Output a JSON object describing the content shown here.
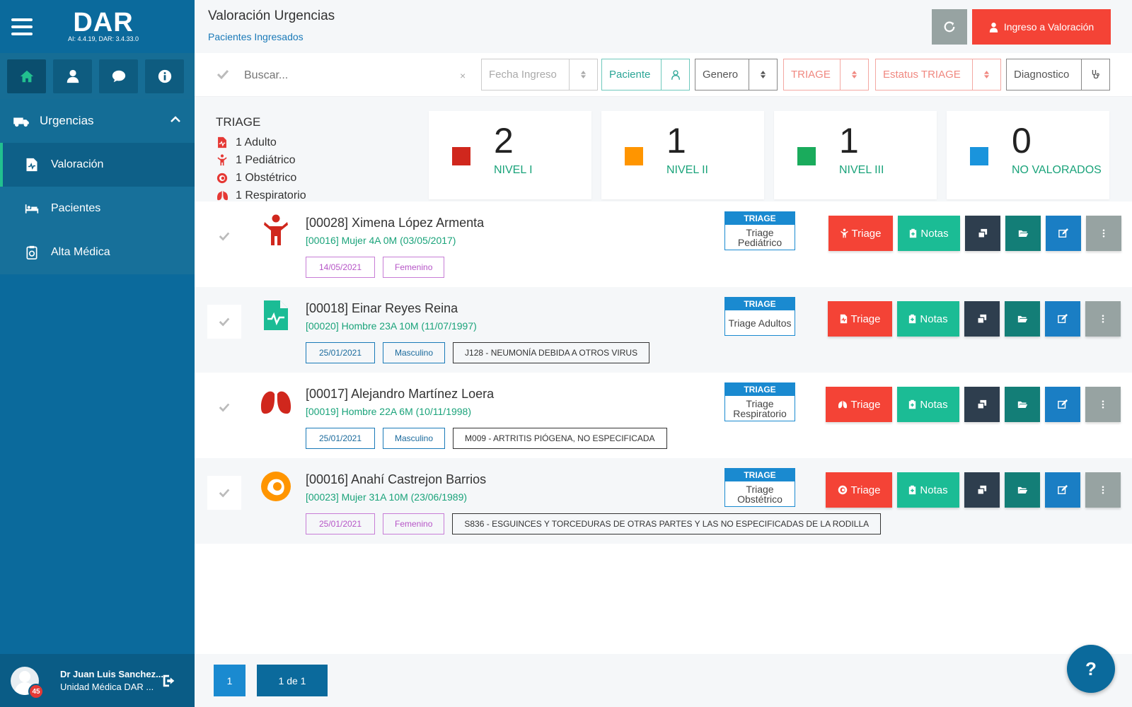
{
  "sidebar": {
    "brand": "DAR",
    "version": "AI: 4.4.19, DAR: 3.4.33.0",
    "section": "Urgencias",
    "items": [
      {
        "label": "Valoración",
        "active": true
      },
      {
        "label": "Pacientes",
        "active": false
      },
      {
        "label": "Alta Médica",
        "active": false
      }
    ],
    "user": {
      "name": "Dr Juan Luis Sanchez...",
      "unit": "Unidad Médica DAR ...",
      "badge": "45"
    }
  },
  "header": {
    "title": "Valoración Urgencias",
    "subtitle": "Pacientes Ingresados",
    "ingreso_label": "Ingreso a Valoración"
  },
  "filters": {
    "search_placeholder": "Buscar...",
    "clear": "×",
    "fecha": "Fecha Ingreso",
    "paciente": "Paciente",
    "genero": "Genero",
    "triage": "TRIAGE",
    "estatus": "Estatus TRIAGE",
    "diagnostico": "Diagnostico"
  },
  "summary": {
    "title": "TRIAGE",
    "rows": [
      "1 Adulto",
      "1 Pediátrico",
      "1 Obstétrico",
      "1 Respiratorio"
    ]
  },
  "levels": [
    {
      "count": "2",
      "label": "NIVEL I",
      "color": "#d0271d"
    },
    {
      "count": "1",
      "label": "NIVEL II",
      "color": "#ff9500"
    },
    {
      "count": "1",
      "label": "NIVEL III",
      "color": "#1aab5c"
    },
    {
      "count": "0",
      "label": "NO VALORADOS",
      "color": "#1a94dc"
    }
  ],
  "patients": [
    {
      "name": "[00028] Ximena López Armenta",
      "info": "[00016] Mujer 4A 0M (03/05/2017)",
      "date": "14/05/2021",
      "gender": "Femenino",
      "diagnosis": "",
      "triage_head": "TRIAGE",
      "triage_type": "Triage Pediátrico",
      "triage_btn": "Triage",
      "notes_btn": "Notas"
    },
    {
      "name": "[00018] Einar Reyes Reina",
      "info": "[00020] Hombre 23A 10M (11/07/1997)",
      "date": "25/01/2021",
      "gender": "Masculino",
      "diagnosis": "J128 - NEUMONÍA DEBIDA A OTROS VIRUS",
      "triage_head": "TRIAGE",
      "triage_type": "Triage Adultos",
      "triage_btn": "Triage",
      "notes_btn": "Notas"
    },
    {
      "name": "[00017] Alejandro Martínez Loera",
      "info": "[00019] Hombre 22A 6M (10/11/1998)",
      "date": "25/01/2021",
      "gender": "Masculino",
      "diagnosis": "M009 - ARTRITIS PIÓGENA, NO ESPECIFICADA",
      "triage_head": "TRIAGE",
      "triage_type": "Triage Respiratorio",
      "triage_btn": "Triage",
      "notes_btn": "Notas"
    },
    {
      "name": "[00016] Anahí Castrejon Barrios",
      "info": "[00023] Mujer 31A 10M (23/06/1989)",
      "date": "25/01/2021",
      "gender": "Femenino",
      "diagnosis": "S836 - ESGUINCES Y TORCEDURAS DE OTRAS PARTES Y LAS NO ESPECIFICADAS DE LA RODILLA",
      "triage_head": "TRIAGE",
      "triage_type": "Triage Obstétrico",
      "triage_btn": "Triage",
      "notes_btn": "Notas"
    }
  ],
  "pagination": {
    "page": "1",
    "of": "1 de 1"
  },
  "help": "?",
  "colors": {
    "primary": "#0b6a9c",
    "accent": "#1bbc95",
    "danger": "#f44336"
  }
}
